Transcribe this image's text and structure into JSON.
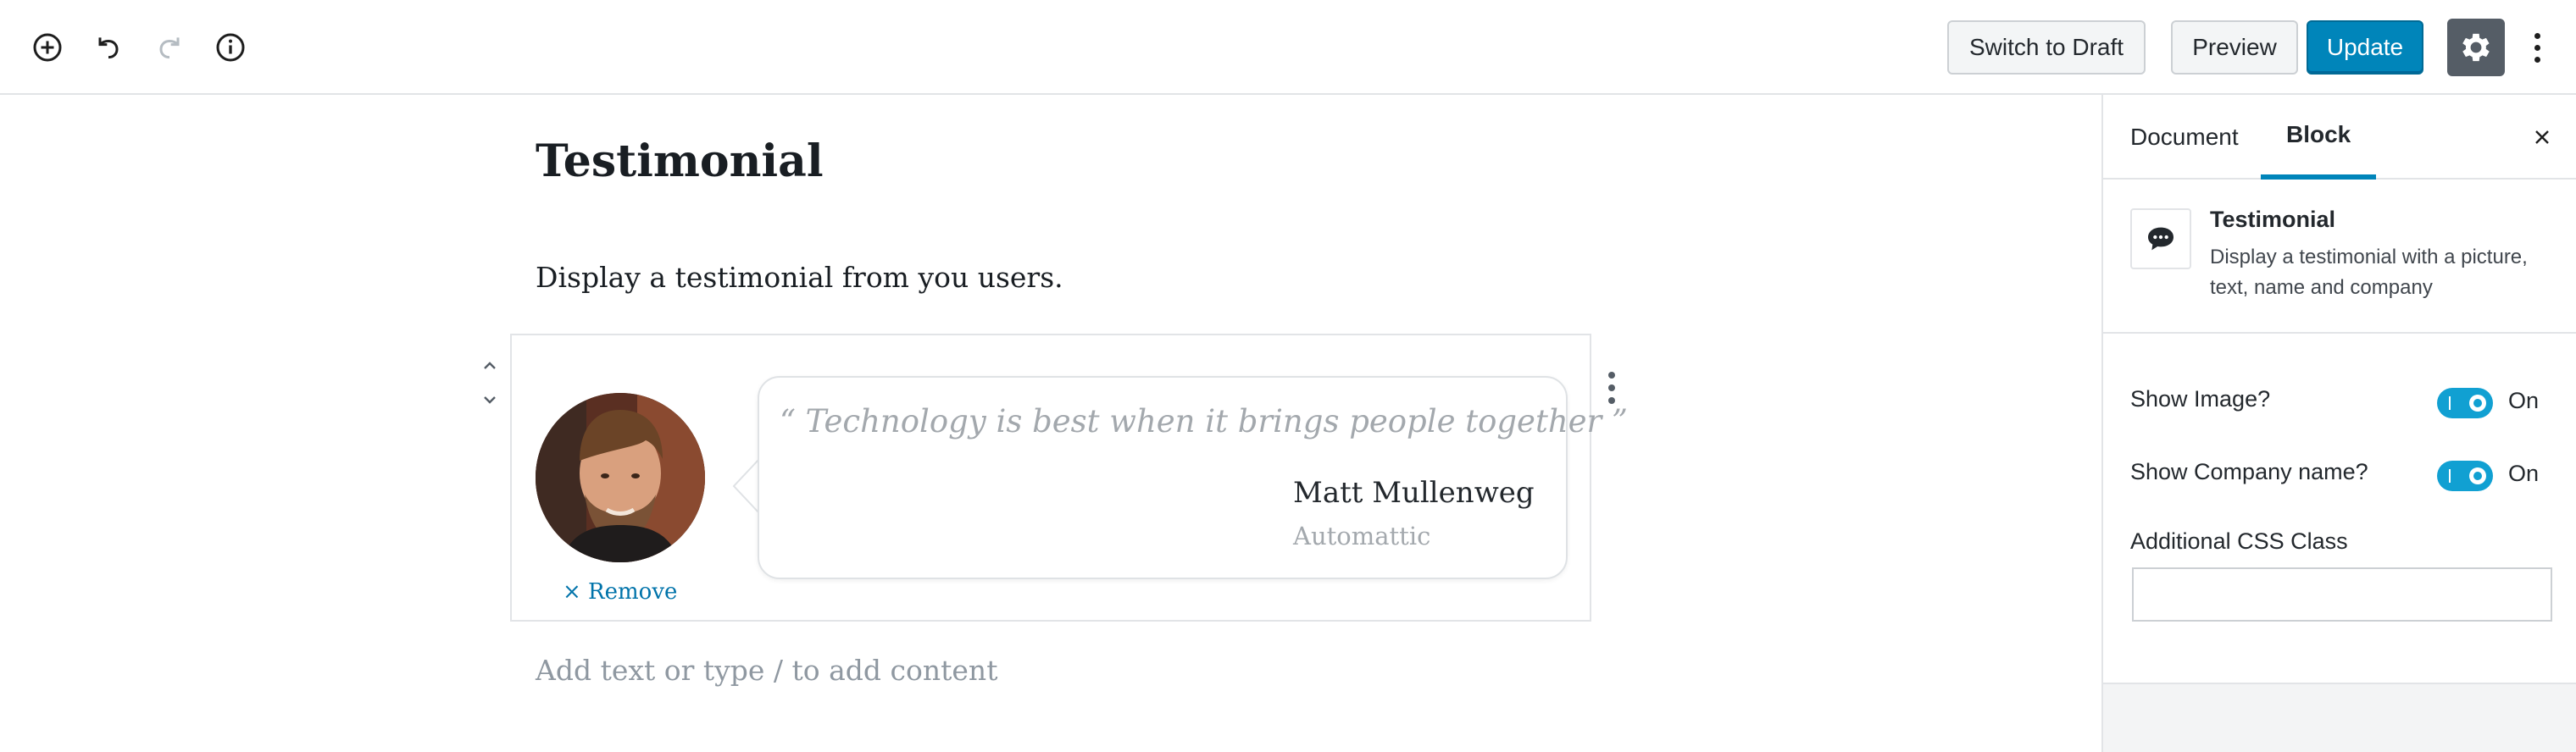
{
  "toolbar": {
    "add_block_icon": "plus-circle-icon",
    "undo_icon": "undo-icon",
    "redo_icon": "redo-icon",
    "info_icon": "info-icon",
    "switch_to_draft_label": "Switch to Draft",
    "preview_label": "Preview",
    "update_label": "Update",
    "settings_icon": "gear-icon",
    "more_icon": "vertical-ellipsis-icon"
  },
  "editor": {
    "post_title": "Testimonial",
    "paragraph": "Display a testimonial from you users.",
    "testimonial_block": {
      "quote": "“ Technology is best when it brings people together ”",
      "name": "Matt Mullenweg",
      "company": "Automattic",
      "remove_label": "× Remove",
      "image": "author-photo"
    },
    "appender_placeholder": "Add text or type / to add content"
  },
  "sidebar": {
    "tabs": [
      {
        "label": "Document",
        "active": false
      },
      {
        "label": "Block",
        "active": true
      }
    ],
    "block_card": {
      "icon": "speech-bubble-icon",
      "title": "Testimonial",
      "description": "Display a testimonial with a picture, text, name and company"
    },
    "settings": {
      "show_image": {
        "label": "Show Image?",
        "state": "On",
        "checked": true
      },
      "show_company": {
        "label": "Show Company name?",
        "state": "On",
        "checked": true
      },
      "css_class": {
        "label": "Additional CSS Class",
        "value": ""
      }
    }
  },
  "colors": {
    "primary": "#0085ba",
    "toggle_on": "#11a0d2",
    "link": "#0073aa",
    "settings_button": "#555d66"
  }
}
